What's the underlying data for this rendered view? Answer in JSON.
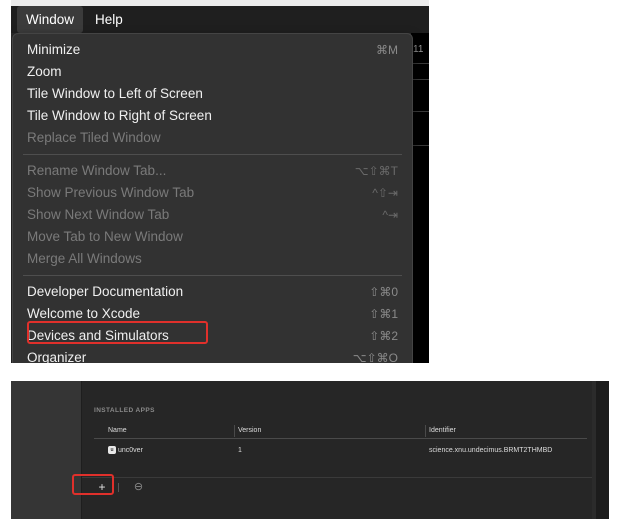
{
  "menubar": {
    "items": [
      {
        "label": "Window",
        "active": true
      },
      {
        "label": "Help",
        "active": false
      }
    ]
  },
  "background_tab_text": "11",
  "menu": {
    "items": [
      {
        "label": "Minimize",
        "shortcut": "⌘M",
        "enabled": true
      },
      {
        "label": "Zoom",
        "shortcut": "",
        "enabled": true
      },
      {
        "label": "Tile Window to Left of Screen",
        "shortcut": "",
        "enabled": true
      },
      {
        "label": "Tile Window to Right of Screen",
        "shortcut": "",
        "enabled": true
      },
      {
        "label": "Replace Tiled Window",
        "shortcut": "",
        "enabled": false
      },
      {
        "label": "Rename Window Tab...",
        "shortcut": "⌥⇧⌘T",
        "enabled": false
      },
      {
        "label": "Show Previous Window Tab",
        "shortcut": "^⇧⇥",
        "enabled": false
      },
      {
        "label": "Show Next Window Tab",
        "shortcut": "^⇥",
        "enabled": false
      },
      {
        "label": "Move Tab to New Window",
        "shortcut": "",
        "enabled": false
      },
      {
        "label": "Merge All Windows",
        "shortcut": "",
        "enabled": false
      },
      {
        "label": "Developer Documentation",
        "shortcut": "⇧⌘0",
        "enabled": true
      },
      {
        "label": "Welcome to Xcode",
        "shortcut": "⇧⌘1",
        "enabled": true
      },
      {
        "label": "Devices and Simulators",
        "shortcut": "⇧⌘2",
        "enabled": true,
        "highlighted": true
      },
      {
        "label": "Organizer",
        "shortcut": "⌥⇧⌘O",
        "enabled": true
      }
    ]
  },
  "devices": {
    "section_title": "INSTALLED APPS",
    "columns": [
      "Name",
      "Version",
      "Identifier"
    ],
    "rows": [
      {
        "icon": "app-icon",
        "name": "unc0ver",
        "version": "1",
        "identifier": "science.xnu.undecimus.BRMT2THMBD"
      }
    ],
    "add_label": "+",
    "remove_label": "⊖"
  },
  "accent_colors": {
    "highlight_box": "#e0302b"
  }
}
